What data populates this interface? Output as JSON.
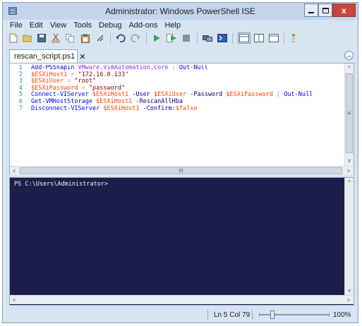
{
  "window": {
    "title": "Administrator: Windows PowerShell ISE",
    "minimize_icon": "minimize-icon",
    "maximize_icon": "maximize-icon",
    "close_icon": "close-icon",
    "close_glyph": "x"
  },
  "menu": [
    "File",
    "Edit",
    "View",
    "Tools",
    "Debug",
    "Add-ons",
    "Help"
  ],
  "toolbar": {
    "icons": [
      "new-script-icon",
      "open-icon",
      "save-icon",
      "cut-icon",
      "copy-icon",
      "paste-icon",
      "clear-console-icon",
      "undo-icon",
      "redo-icon",
      "run-icon",
      "run-selection-icon",
      "stop-icon",
      "new-remote-tab-icon",
      "start-powershell-icon",
      "show-script-pane-top-icon",
      "show-script-pane-right-icon",
      "show-script-pane-maximized-icon",
      "show-command-addon-icon"
    ]
  },
  "tab": {
    "label": "rescan_script.ps1",
    "close_glyph": "✕"
  },
  "script": {
    "lines": [
      {
        "num": "1",
        "tokens": [
          {
            "t": "Add-PSSnapin",
            "k": "cmd"
          },
          {
            "t": " VMware.VimAutomation.Core ",
            "k": "plain"
          },
          {
            "t": "|",
            "k": "op"
          },
          {
            "t": " Out-Null",
            "k": "cmd"
          }
        ]
      },
      {
        "num": "2",
        "tokens": [
          {
            "t": "$ESXiHost1",
            "k": "var"
          },
          {
            "t": " = ",
            "k": "op"
          },
          {
            "t": "\"172.16.0.133\"",
            "k": "str"
          }
        ]
      },
      {
        "num": "3",
        "tokens": [
          {
            "t": "$ESXiUser",
            "k": "var"
          },
          {
            "t": " = ",
            "k": "op"
          },
          {
            "t": "\"root\"",
            "k": "str"
          }
        ]
      },
      {
        "num": "4",
        "tokens": [
          {
            "t": "$ESXiPassword",
            "k": "var"
          },
          {
            "t": " = ",
            "k": "op"
          },
          {
            "t": "\"password\"",
            "k": "str"
          }
        ]
      },
      {
        "num": "5",
        "tokens": [
          {
            "t": "Connect-VIServer",
            "k": "cmd"
          },
          {
            "t": " ",
            "k": "plain"
          },
          {
            "t": "$ESXiHost1",
            "k": "var"
          },
          {
            "t": " -User",
            "k": "param"
          },
          {
            "t": " ",
            "k": "plain"
          },
          {
            "t": "$ESXiUser",
            "k": "var"
          },
          {
            "t": " -Password",
            "k": "param"
          },
          {
            "t": " ",
            "k": "plain"
          },
          {
            "t": "$ESXiPassword",
            "k": "var"
          },
          {
            "t": " | ",
            "k": "op"
          },
          {
            "t": "Out-Null",
            "k": "cmd"
          }
        ]
      },
      {
        "num": "6",
        "tokens": [
          {
            "t": "Get-VMHostStorage",
            "k": "cmd"
          },
          {
            "t": " ",
            "k": "plain"
          },
          {
            "t": "$ESXiHost1",
            "k": "var"
          },
          {
            "t": " -RescanAllHba",
            "k": "param"
          }
        ]
      },
      {
        "num": "7",
        "tokens": [
          {
            "t": "Disconnect-VIServer",
            "k": "cmd"
          },
          {
            "t": " ",
            "k": "plain"
          },
          {
            "t": "$ESXiHost1",
            "k": "var"
          },
          {
            "t": " -Confirm:",
            "k": "param"
          },
          {
            "t": "$false",
            "k": "var"
          }
        ]
      }
    ]
  },
  "editor_scroll": {
    "up_arrow": "^",
    "down_arrow": "v",
    "left_arrow": "<",
    "right_arrow": ">",
    "grip": "III",
    "vgrip": "≡"
  },
  "console": {
    "prompt": "PS C:\\Users\\Administrator>"
  },
  "status": {
    "position": "Ln 5  Col 79",
    "zoom": "100%"
  }
}
